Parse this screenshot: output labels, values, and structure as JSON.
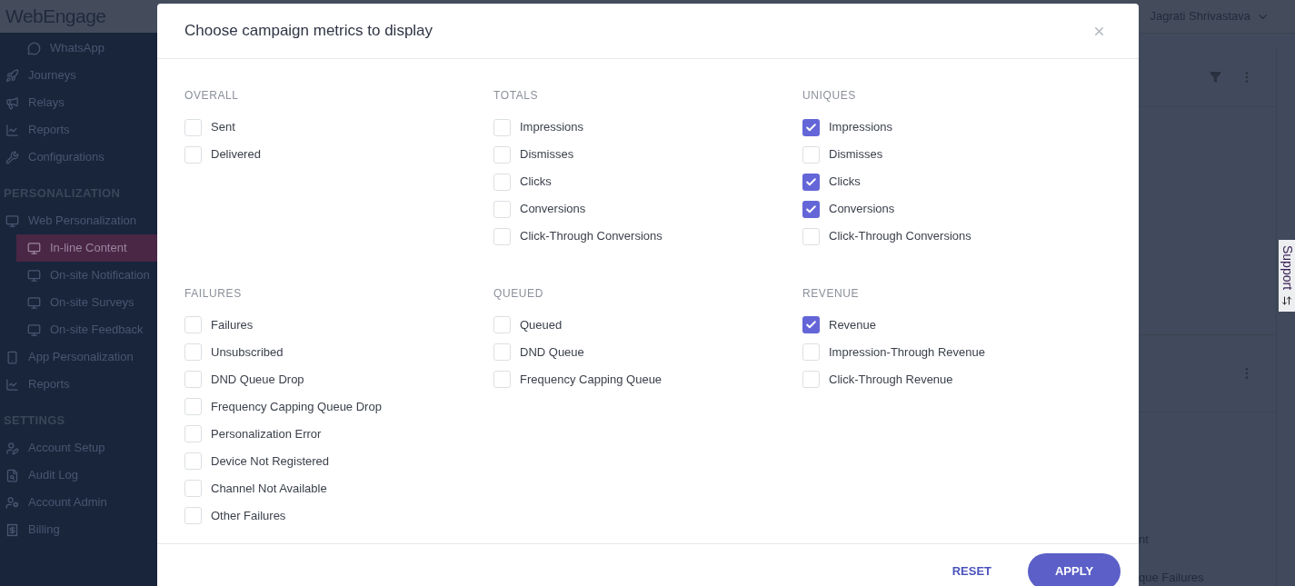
{
  "brand": "WebEngage",
  "sidebar": {
    "items": [
      {
        "label": "WhatsApp",
        "kind": "subitem",
        "selected": false
      },
      {
        "label": "Journeys",
        "kind": "item",
        "selected": false
      },
      {
        "label": "Relays",
        "kind": "item",
        "selected": false
      },
      {
        "label": "Reports",
        "kind": "item",
        "selected": false
      },
      {
        "label": "Configurations",
        "kind": "item",
        "selected": false
      },
      {
        "label": "PERSONALIZATION",
        "kind": "heading"
      },
      {
        "label": "Web Personalization",
        "kind": "item",
        "selected": false
      },
      {
        "label": "In-line Content",
        "kind": "subitem",
        "selected": true
      },
      {
        "label": "On-site Notification",
        "kind": "subitem",
        "selected": false
      },
      {
        "label": "On-site Surveys",
        "kind": "subitem",
        "selected": false
      },
      {
        "label": "On-site Feedback",
        "kind": "subitem",
        "selected": false
      },
      {
        "label": "App Personalization",
        "kind": "item",
        "selected": false
      },
      {
        "label": "Reports",
        "kind": "item",
        "selected": false
      },
      {
        "label": "SETTINGS",
        "kind": "heading"
      },
      {
        "label": "Account Setup",
        "kind": "item",
        "selected": false
      },
      {
        "label": "Audit Log",
        "kind": "item",
        "selected": false
      },
      {
        "label": "Account Admin",
        "kind": "item",
        "selected": false
      },
      {
        "label": "Billing",
        "kind": "item",
        "selected": false
      }
    ]
  },
  "header": {
    "user": "Jagrati Shrivastava"
  },
  "background": {
    "texts": [
      "nt",
      "que Failures"
    ]
  },
  "support_tab": {
    "label": "Support"
  },
  "dialog": {
    "title": "Choose campaign metrics to display",
    "groups": [
      {
        "title": "OVERALL",
        "items": [
          {
            "label": "Sent",
            "checked": false
          },
          {
            "label": "Delivered",
            "checked": false
          }
        ]
      },
      {
        "title": "TOTALS",
        "items": [
          {
            "label": "Impressions",
            "checked": false
          },
          {
            "label": "Dismisses",
            "checked": false
          },
          {
            "label": "Clicks",
            "checked": false
          },
          {
            "label": "Conversions",
            "checked": false
          },
          {
            "label": "Click-Through Conversions",
            "checked": false
          }
        ]
      },
      {
        "title": "UNIQUES",
        "items": [
          {
            "label": "Impressions",
            "checked": true
          },
          {
            "label": "Dismisses",
            "checked": false
          },
          {
            "label": "Clicks",
            "checked": true
          },
          {
            "label": "Conversions",
            "checked": true
          },
          {
            "label": "Click-Through Conversions",
            "checked": false
          }
        ]
      },
      {
        "title": "FAILURES",
        "items": [
          {
            "label": "Failures",
            "checked": false
          },
          {
            "label": "Unsubscribed",
            "checked": false
          },
          {
            "label": "DND Queue Drop",
            "checked": false
          },
          {
            "label": "Frequency Capping Queue Drop",
            "checked": false
          },
          {
            "label": "Personalization Error",
            "checked": false
          },
          {
            "label": "Device Not Registered",
            "checked": false
          },
          {
            "label": "Channel Not Available",
            "checked": false
          },
          {
            "label": "Other Failures",
            "checked": false
          }
        ]
      },
      {
        "title": "QUEUED",
        "items": [
          {
            "label": "Queued",
            "checked": false
          },
          {
            "label": "DND Queue",
            "checked": false
          },
          {
            "label": "Frequency Capping Queue",
            "checked": false
          }
        ]
      },
      {
        "title": "REVENUE",
        "items": [
          {
            "label": "Revenue",
            "checked": true
          },
          {
            "label": "Impression-Through Revenue",
            "checked": false
          },
          {
            "label": "Click-Through Revenue",
            "checked": false
          }
        ]
      }
    ],
    "buttons": [
      {
        "label": "RESET",
        "kind": "text"
      },
      {
        "label": "APPLY",
        "kind": "primary"
      }
    ]
  }
}
